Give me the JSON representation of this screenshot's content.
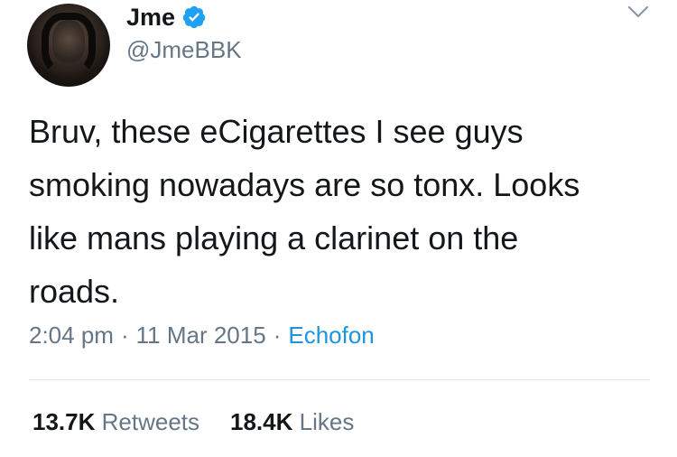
{
  "author": {
    "display_name": "Jme",
    "username": "@JmeBBK",
    "avatar_icon": "profile-photo",
    "verified_icon": "verified-badge-icon",
    "verified_color": "#1da1f2"
  },
  "tweet": {
    "text": "Bruv, these eCigarettes I see guys\nsmoking nowadays are so tonx. Looks\nlike mans playing a clarinet on the\nroads."
  },
  "meta": {
    "time": "2:04 pm",
    "separator": "·",
    "date": "11 Mar 2015",
    "source": "Echofon",
    "source_color": "#1b95e0"
  },
  "stats": {
    "retweets_count": "13.7K",
    "retweets_label": "Retweets",
    "likes_count": "18.4K",
    "likes_label": "Likes"
  },
  "menu_icon": "chevron-down-icon"
}
